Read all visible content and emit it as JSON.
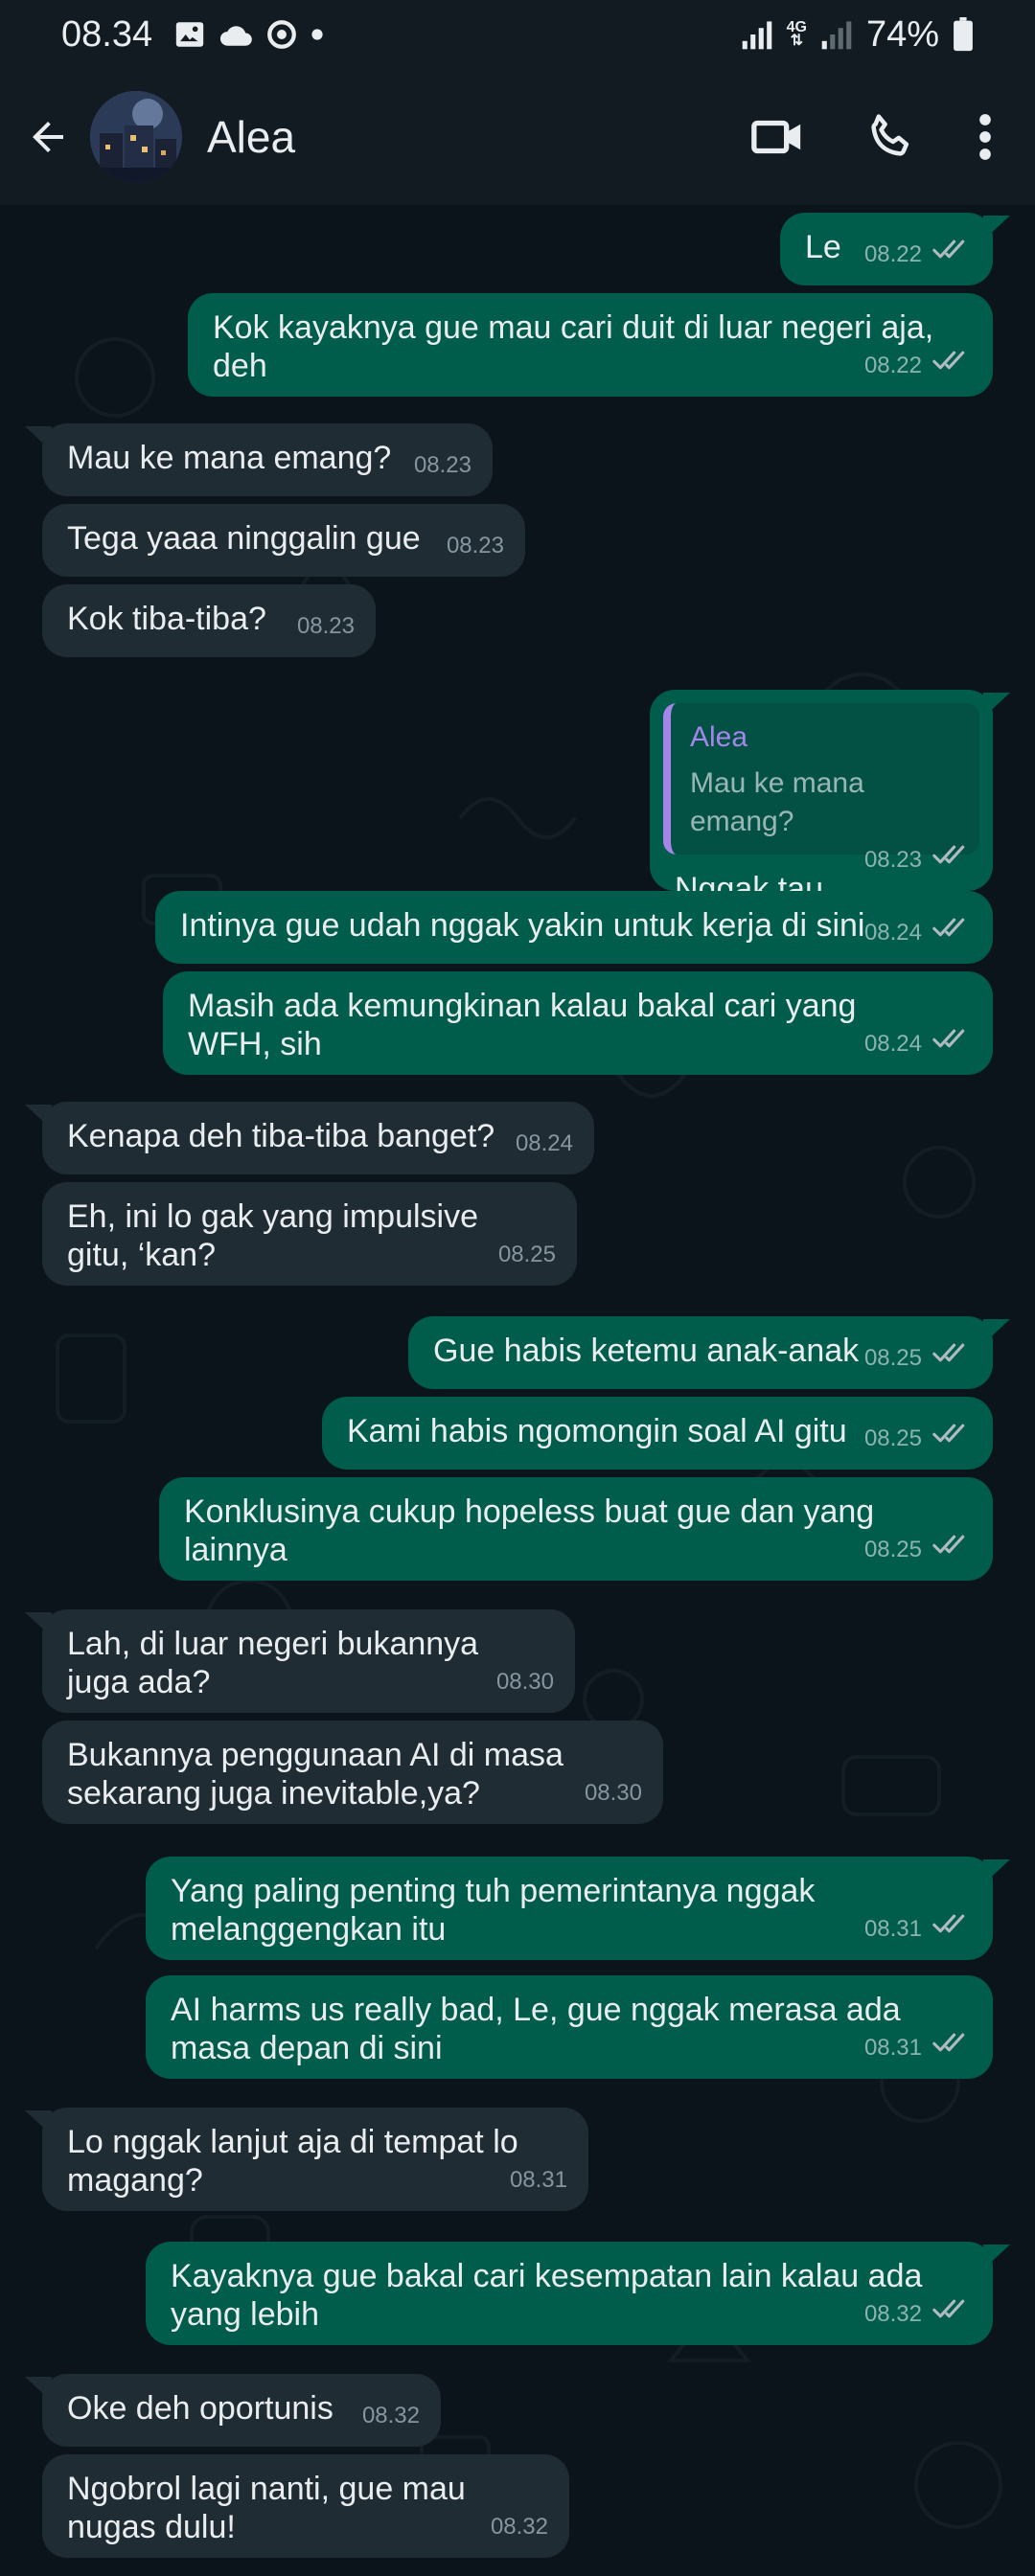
{
  "status_bar": {
    "time": "08.34",
    "network_label": "4G",
    "battery": "74%"
  },
  "header": {
    "contact_name": "Alea",
    "icons": [
      "back-arrow-icon",
      "avatar",
      "video-call-icon",
      "phone-icon",
      "more-vert-icon"
    ]
  },
  "colors": {
    "chat_bg": "#0b141a",
    "incoming_bubble": "#202c33",
    "outgoing_bubble": "#005c4b",
    "quote_accent": "#a586e8",
    "read_tick": "#b0bac0"
  },
  "messages": [
    {
      "dir": "out",
      "text": "Le",
      "time": "08.22"
    },
    {
      "dir": "out",
      "text": "Kok kayaknya gue mau cari duit di luar negeri aja, deh",
      "time": "08.22"
    },
    {
      "dir": "in",
      "text": "Mau ke mana emang?",
      "time": "08.23"
    },
    {
      "dir": "in",
      "text": "Tega yaaa ninggalin gue",
      "time": "08.23"
    },
    {
      "dir": "in",
      "text": "Kok tiba-tiba?",
      "time": "08.23"
    },
    {
      "dir": "out",
      "text": "Nggak tau",
      "time": "08.23",
      "quote": {
        "name": "Alea",
        "text": "Mau ke mana emang?"
      }
    },
    {
      "dir": "out",
      "text": "Intinya gue udah nggak yakin untuk kerja di sini",
      "time": "08.24"
    },
    {
      "dir": "out",
      "text": "Masih ada kemungkinan kalau bakal cari yang WFH, sih",
      "time": "08.24"
    },
    {
      "dir": "in",
      "text": "Kenapa deh tiba-tiba banget?",
      "time": "08.24"
    },
    {
      "dir": "in",
      "text": "Eh, ini lo gak yang impulsive gitu, ‘kan?",
      "time": "08.25"
    },
    {
      "dir": "out",
      "text": "Gue habis ketemu anak-anak",
      "time": "08.25"
    },
    {
      "dir": "out",
      "text": "Kami habis ngomongin soal AI gitu",
      "time": "08.25"
    },
    {
      "dir": "out",
      "text": "Konklusinya cukup hopeless buat gue dan yang lainnya",
      "time": "08.25"
    },
    {
      "dir": "in",
      "text": "Lah, di luar negeri bukannya juga ada?",
      "time": "08.30"
    },
    {
      "dir": "in",
      "text": "Bukannya penggunaan AI di masa sekarang juga inevitable,ya?",
      "time": "08.30"
    },
    {
      "dir": "out",
      "text": "Yang paling penting tuh pemerintanya nggak melanggengkan itu",
      "time": "08.31"
    },
    {
      "dir": "out",
      "text": "AI harms us really bad, Le, gue nggak merasa ada masa depan di sini",
      "time": "08.31"
    },
    {
      "dir": "in",
      "text": "Lo nggak lanjut aja di tempat lo magang?",
      "time": "08.31"
    },
    {
      "dir": "out",
      "text": "Kayaknya gue bakal cari kesempatan lain kalau ada yang lebih",
      "time": "08.32"
    },
    {
      "dir": "in",
      "text": "Oke deh oportunis",
      "time": "08.32"
    },
    {
      "dir": "in",
      "text": "Ngobrol lagi nanti, gue mau nugas dulu!",
      "time": "08.32"
    }
  ]
}
